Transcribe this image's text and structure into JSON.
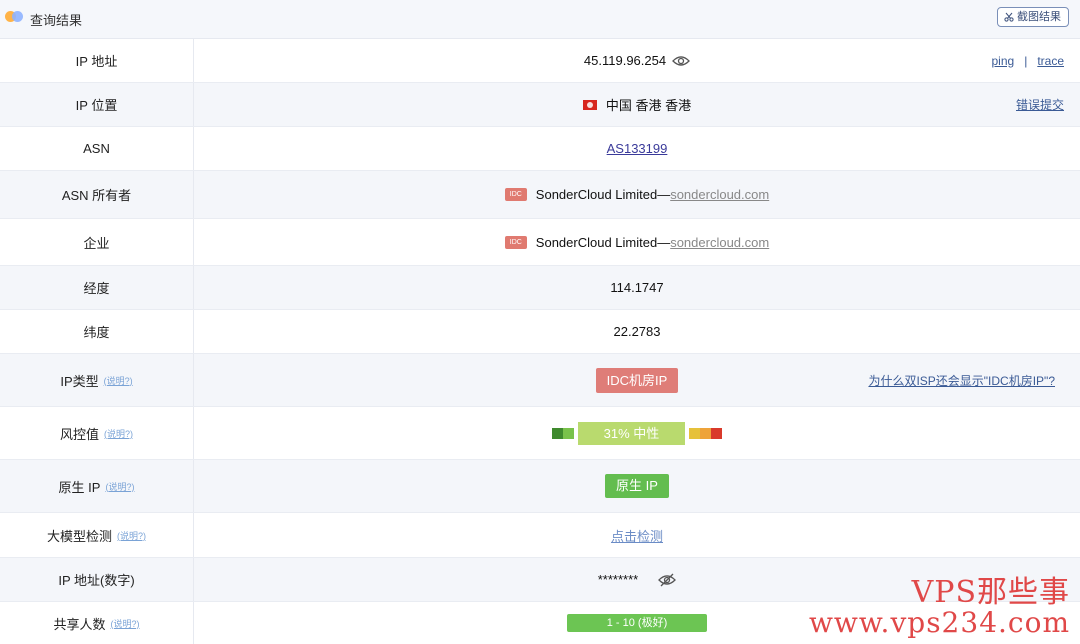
{
  "header": {
    "title": "查询结果",
    "screenshot_label": "截图结果"
  },
  "rows": {
    "ip": {
      "label": "IP 地址",
      "value": "45.119.96.254",
      "ping": "ping",
      "separator": "|",
      "trace": "trace"
    },
    "location": {
      "label": "IP 位置",
      "value": "中国 香港 香港",
      "report": "错误提交"
    },
    "asn": {
      "label": "ASN",
      "value": "AS133199"
    },
    "asn_owner": {
      "label": "ASN 所有者",
      "badge": "IDC",
      "name": "SonderCloud Limited—",
      "domain": "sondercloud.com"
    },
    "company": {
      "label": "企业",
      "badge": "IDC",
      "name": "SonderCloud Limited—",
      "domain": "sondercloud.com"
    },
    "longitude": {
      "label": "经度",
      "value": "114.1747"
    },
    "latitude": {
      "label": "纬度",
      "value": "22.2783"
    },
    "ip_type": {
      "label": "IP类型",
      "help": "(说明?)",
      "tag": "IDC机房IP",
      "question": "为什么双ISP还会显示\"IDC机房IP\"?"
    },
    "risk": {
      "label": "风控值",
      "help": "(说明?)",
      "score_text": "31%  中性",
      "score": 31,
      "colors": [
        "#3f8a2e",
        "#79c24b",
        "#b9da6e",
        "#e6c13a",
        "#eea33a",
        "#d93a2b"
      ]
    },
    "native_ip": {
      "label": "原生 IP",
      "help": "(说明?)",
      "tag": "原生 IP"
    },
    "llm": {
      "label": "大模型检测",
      "help": "(说明?)",
      "action": "点击检测"
    },
    "ip_numeric": {
      "label": "IP 地址(数字)",
      "value": "********"
    },
    "shared": {
      "label": "共享人数",
      "help": "(说明?)",
      "value": "1 - 10 (极好)"
    }
  },
  "watermark": {
    "line1": "VPS那些事",
    "line2": "www.vps234.com"
  }
}
